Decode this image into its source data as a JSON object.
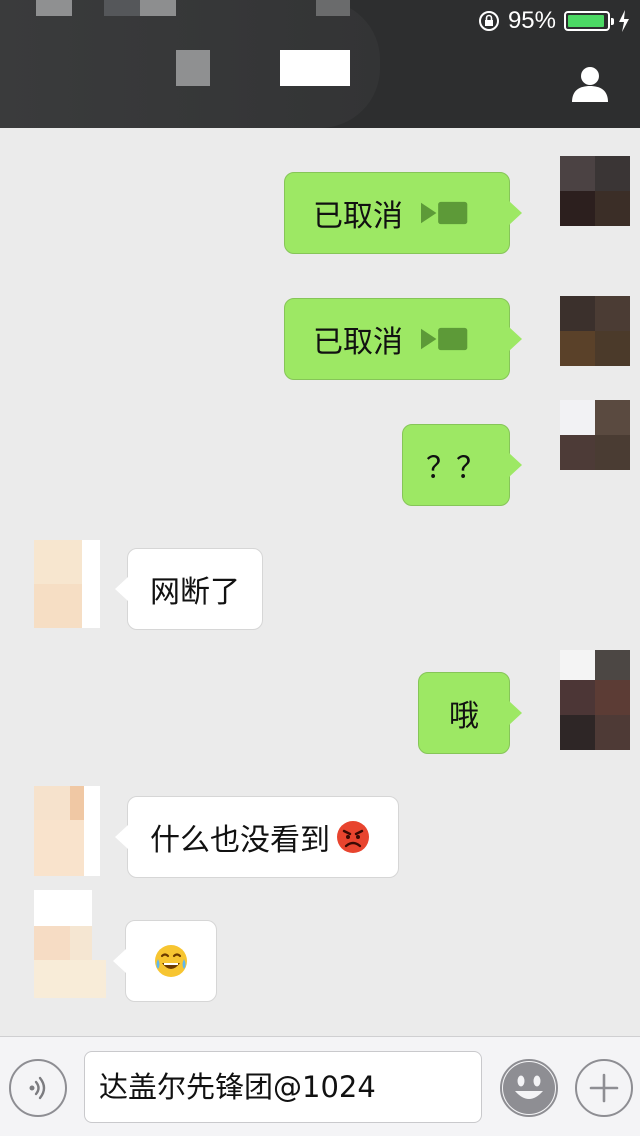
{
  "status_bar": {
    "battery_percent": "95%",
    "battery_level": 0.95,
    "icons": [
      "orientation-lock-icon",
      "battery-icon",
      "charging-bolt-icon"
    ]
  },
  "header": {
    "profile_icon": "person-icon"
  },
  "messages": [
    {
      "side": "me",
      "kind": "voice-cancelled",
      "text": "已取消"
    },
    {
      "side": "me",
      "kind": "voice-cancelled",
      "text": "已取消"
    },
    {
      "side": "me",
      "kind": "text",
      "text": "？？"
    },
    {
      "side": "them",
      "kind": "text",
      "text": "网断了"
    },
    {
      "side": "me",
      "kind": "text",
      "text": "哦"
    },
    {
      "side": "them",
      "kind": "text",
      "text": "什么也没看到",
      "emoji": "angry-face-icon"
    },
    {
      "side": "them",
      "kind": "emoji",
      "emoji": "tears-of-joy-face-icon"
    }
  ],
  "composer": {
    "input_value": "达盖尔先锋团@1024",
    "left_button_icon": "voice-icon",
    "emoji_button_icon": "smiley-icon",
    "plus_button_icon": "plus-icon"
  },
  "colors": {
    "header_bg": "#2d2e2f",
    "chat_bg": "#ebebeb",
    "my_bubble": "#9de864",
    "their_bubble": "#ffffff",
    "battery_fill": "#4cd964"
  }
}
